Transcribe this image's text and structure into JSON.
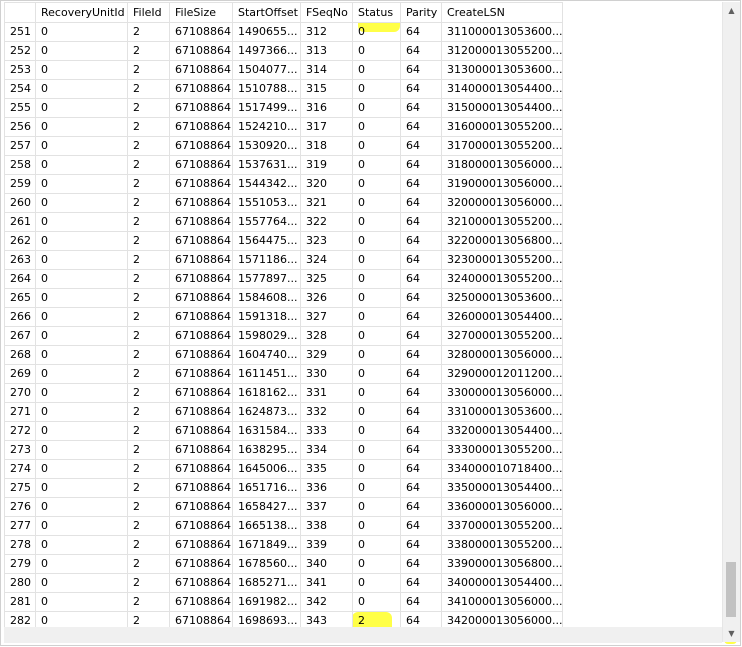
{
  "columns": [
    "",
    "RecoveryUnitId",
    "FileId",
    "FileSize",
    "StartOffset",
    "FSeqNo",
    "Status",
    "Parity",
    "CreateLSN"
  ],
  "rows": [
    [
      "251",
      "0",
      "2",
      "67108864",
      "1490655...",
      "312",
      "0",
      "64",
      "311000013053600..."
    ],
    [
      "252",
      "0",
      "2",
      "67108864",
      "1497366...",
      "313",
      "0",
      "64",
      "312000013055200..."
    ],
    [
      "253",
      "0",
      "2",
      "67108864",
      "1504077...",
      "314",
      "0",
      "64",
      "313000013053600..."
    ],
    [
      "254",
      "0",
      "2",
      "67108864",
      "1510788...",
      "315",
      "0",
      "64",
      "314000013054400..."
    ],
    [
      "255",
      "0",
      "2",
      "67108864",
      "1517499...",
      "316",
      "0",
      "64",
      "315000013054400..."
    ],
    [
      "256",
      "0",
      "2",
      "67108864",
      "1524210...",
      "317",
      "0",
      "64",
      "316000013055200..."
    ],
    [
      "257",
      "0",
      "2",
      "67108864",
      "1530920...",
      "318",
      "0",
      "64",
      "317000013055200..."
    ],
    [
      "258",
      "0",
      "2",
      "67108864",
      "1537631...",
      "319",
      "0",
      "64",
      "318000013056000..."
    ],
    [
      "259",
      "0",
      "2",
      "67108864",
      "1544342...",
      "320",
      "0",
      "64",
      "319000013056000..."
    ],
    [
      "260",
      "0",
      "2",
      "67108864",
      "1551053...",
      "321",
      "0",
      "64",
      "320000013056000..."
    ],
    [
      "261",
      "0",
      "2",
      "67108864",
      "1557764...",
      "322",
      "0",
      "64",
      "321000013055200..."
    ],
    [
      "262",
      "0",
      "2",
      "67108864",
      "1564475...",
      "323",
      "0",
      "64",
      "322000013056800..."
    ],
    [
      "263",
      "0",
      "2",
      "67108864",
      "1571186...",
      "324",
      "0",
      "64",
      "323000013055200..."
    ],
    [
      "264",
      "0",
      "2",
      "67108864",
      "1577897...",
      "325",
      "0",
      "64",
      "324000013055200..."
    ],
    [
      "265",
      "0",
      "2",
      "67108864",
      "1584608...",
      "326",
      "0",
      "64",
      "325000013053600..."
    ],
    [
      "266",
      "0",
      "2",
      "67108864",
      "1591318...",
      "327",
      "0",
      "64",
      "326000013054400..."
    ],
    [
      "267",
      "0",
      "2",
      "67108864",
      "1598029...",
      "328",
      "0",
      "64",
      "327000013055200..."
    ],
    [
      "268",
      "0",
      "2",
      "67108864",
      "1604740...",
      "329",
      "0",
      "64",
      "328000013056000..."
    ],
    [
      "269",
      "0",
      "2",
      "67108864",
      "1611451...",
      "330",
      "0",
      "64",
      "329000012011200..."
    ],
    [
      "270",
      "0",
      "2",
      "67108864",
      "1618162...",
      "331",
      "0",
      "64",
      "330000013056000..."
    ],
    [
      "271",
      "0",
      "2",
      "67108864",
      "1624873...",
      "332",
      "0",
      "64",
      "331000013053600..."
    ],
    [
      "272",
      "0",
      "2",
      "67108864",
      "1631584...",
      "333",
      "0",
      "64",
      "332000013054400..."
    ],
    [
      "273",
      "0",
      "2",
      "67108864",
      "1638295...",
      "334",
      "0",
      "64",
      "333000013055200..."
    ],
    [
      "274",
      "0",
      "2",
      "67108864",
      "1645006...",
      "335",
      "0",
      "64",
      "334000010718400..."
    ],
    [
      "275",
      "0",
      "2",
      "67108864",
      "1651716...",
      "336",
      "0",
      "64",
      "335000013054400..."
    ],
    [
      "276",
      "0",
      "2",
      "67108864",
      "1658427...",
      "337",
      "0",
      "64",
      "336000013056000..."
    ],
    [
      "277",
      "0",
      "2",
      "67108864",
      "1665138...",
      "338",
      "0",
      "64",
      "337000013055200..."
    ],
    [
      "278",
      "0",
      "2",
      "67108864",
      "1671849...",
      "339",
      "0",
      "64",
      "338000013055200..."
    ],
    [
      "279",
      "0",
      "2",
      "67108864",
      "1678560...",
      "340",
      "0",
      "64",
      "339000013056800..."
    ],
    [
      "280",
      "0",
      "2",
      "67108864",
      "1685271...",
      "341",
      "0",
      "64",
      "340000013054400..."
    ],
    [
      "281",
      "0",
      "2",
      "67108864",
      "1691982...",
      "342",
      "0",
      "64",
      "341000013056000..."
    ],
    [
      "282",
      "0",
      "2",
      "67108864",
      "1698693...",
      "343",
      "2",
      "64",
      "342000013056000..."
    ]
  ],
  "colors": {
    "highlight": "#ffff33",
    "gridline": "#e2e2e2",
    "scrollbar": "#f0f0f0"
  },
  "icons": {
    "scroll_up": "triangle-up-icon",
    "scroll_down": "triangle-down-icon"
  }
}
